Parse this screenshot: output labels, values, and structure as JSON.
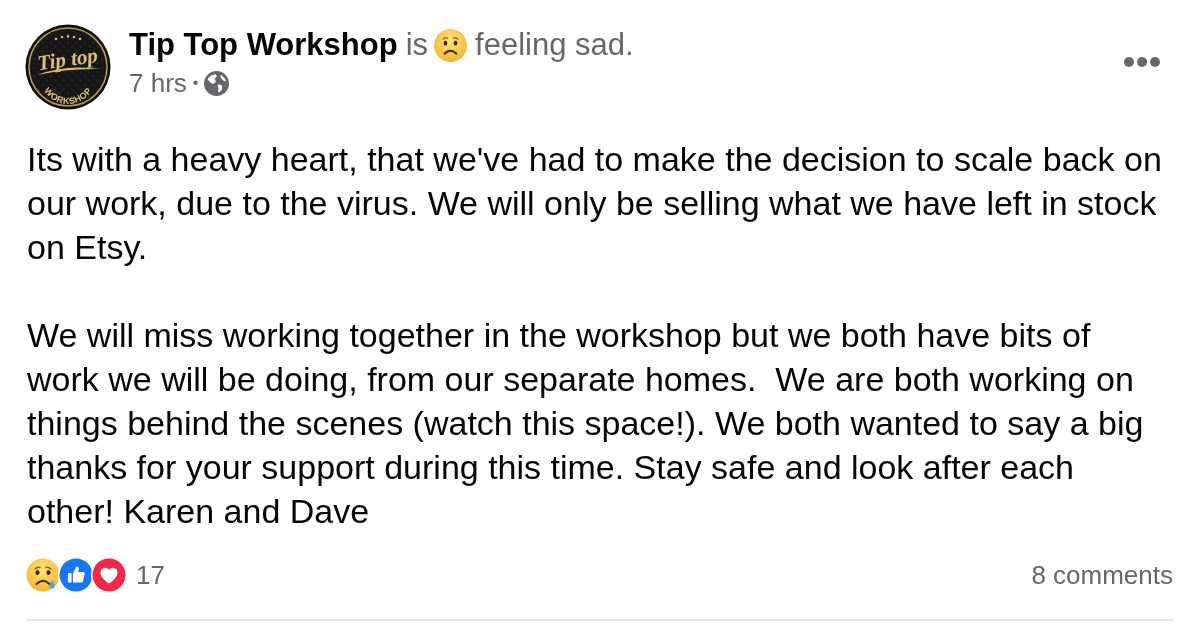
{
  "post": {
    "logo": {
      "script": "Tip top",
      "banner": "WORKSHOP"
    },
    "author": "Tip Top Workshop",
    "connector": "is",
    "feeling": "feeling sad.",
    "time": "7 hrs",
    "separator": "•",
    "body": [
      "Its with a heavy heart, that we've had to make the decision to scale back on our work, due to the virus. We will only be selling what we have left in stock on Etsy.",
      "We will miss working together in the workshop but we both have bits of work we will be doing, from our separate homes.  We are both working on things behind the scenes (watch this space!). We both wanted to say a big thanks for your support during this time. Stay safe and look after each other! Karen and Dave"
    ],
    "reactions": [
      {
        "kind": "sad"
      },
      {
        "kind": "like"
      },
      {
        "kind": "love"
      }
    ],
    "reaction_count": "17",
    "comments": "8 comments"
  }
}
